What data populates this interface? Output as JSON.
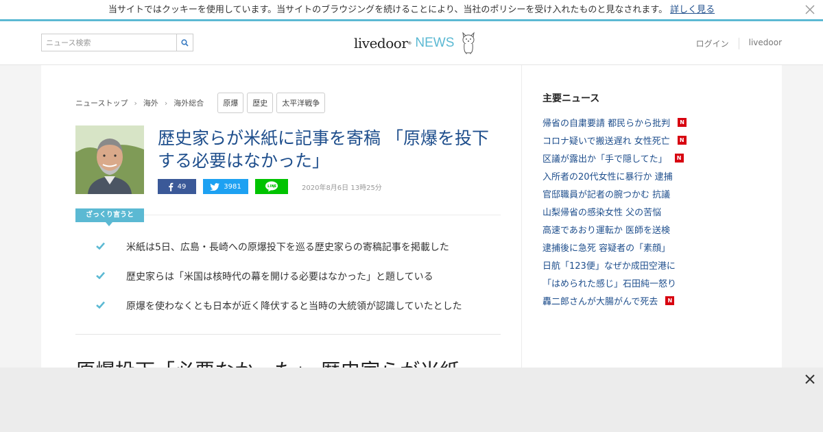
{
  "cookie_bar": {
    "message": "当サイトではクッキーを使用しています。当サイトのブラウジングを続けることにより、当社のポリシーを受け入れたものと見なされます。",
    "link": "詳しく見る",
    "close_icon": "close-icon"
  },
  "header": {
    "search_placeholder": "ニュース検索",
    "search_icon": "search-icon",
    "logo_brand": "livedoor",
    "logo_reg": "®",
    "logo_news": "NEWS",
    "nav": [
      "ログイン",
      "livedoor"
    ]
  },
  "breadcrumb": [
    "ニューストップ",
    "海外",
    "海外総合"
  ],
  "tags": [
    "原爆",
    "歴史",
    "太平洋戦争"
  ],
  "article": {
    "title": "歴史家らが米紙に記事を寄稿 「原爆を投下する必要はなかった」",
    "share": {
      "facebook": "49",
      "twitter": "3981",
      "line_icon": "line-icon"
    },
    "date": "2020年8月6日 13時25分",
    "summary_label": "ざっくり言うと",
    "points": [
      "米紙は5日、広島・長崎への原爆投下を巡る歴史家らの寄稿記事を掲載した",
      "歴史家らは「米国は核時代の幕を開ける必要はなかった」と題している",
      "原爆を使わなくとも日本が近く降伏すると当時の大統領が認識していたとした"
    ],
    "heading": "原爆投下「必要なかった」 歴史家らが米紙"
  },
  "sidebar": {
    "title": "主要ニュース",
    "items": [
      {
        "text": "帰省の自粛要請 都民らから批判",
        "badge": "N"
      },
      {
        "text": "コロナ疑いで搬送遅れ 女性死亡",
        "badge": "N"
      },
      {
        "text": "区議が露出か「手で隠してた」",
        "badge": "N"
      },
      {
        "text": "入所者の20代女性に暴行か 逮捕",
        "badge": ""
      },
      {
        "text": "官邸職員が記者の腕つかむ 抗議",
        "badge": ""
      },
      {
        "text": "山梨帰省の感染女性 父の苦悩",
        "badge": ""
      },
      {
        "text": "高速であおり運転か 医師を送検",
        "badge": ""
      },
      {
        "text": "逮捕後に急死 容疑者の「素顔」",
        "badge": ""
      },
      {
        "text": "日航「123便」なぜか成田空港に",
        "badge": ""
      },
      {
        "text": "「はめられた感じ」石田純一怒り",
        "badge": ""
      },
      {
        "text": "轟二郎さんが大腸がんで死去",
        "badge": "N"
      }
    ]
  },
  "colors": {
    "accent": "#5bb9d3",
    "link": "#1e4e8c",
    "facebook": "#3b5998",
    "twitter": "#1da1f2",
    "line": "#00c300",
    "new_badge": "#d7000f"
  }
}
